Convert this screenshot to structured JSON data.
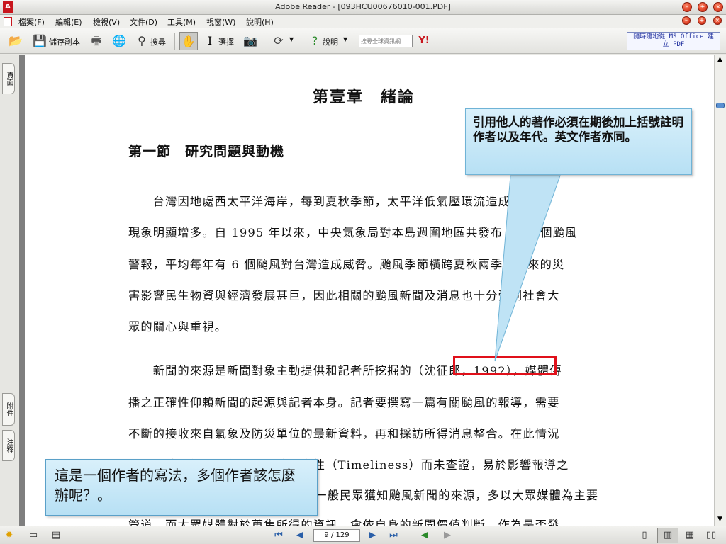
{
  "window": {
    "title": "Adobe Reader - [093HCU00676010-001.PDF]"
  },
  "menu": [
    "檔案(F)",
    "編輯(E)",
    "檢視(V)",
    "文件(D)",
    "工具(M)",
    "視窗(W)",
    "說明(H)"
  ],
  "toolbar": {
    "save_copy": "儲存副本",
    "search": "搜尋",
    "select": "選擇",
    "help": "說明",
    "search_placeholder": "搜尋全球資訊網",
    "ad_line1": "隨時隨地從 MS Office 建",
    "ad_line2": "立 PDF"
  },
  "leftpanel": {
    "pages_tab": "頁面",
    "attachments_tab": "附件",
    "comments_tab": "注釋"
  },
  "document": {
    "chapter_title": "第壹章　緒論",
    "section_title": "第一節　研究問題與動機",
    "p1": [
      "　　台灣因地處西太平洋海岸，每到夏秋季節，太平洋低氣壓環流造成的氣候",
      "現象明顯增多。自 1995 年以來，中央氣象局對本島週圍地區共發布 80 多個颱風",
      "警報，平均每年有 6 個颱風對台灣造成威脅。颱風季節橫跨夏秋兩季，帶來的災",
      "害影響民生物資與經濟發展甚巨，因此相關的颱風新聞及消息也十分受到社會大",
      "眾的關心與重視。"
    ],
    "p2": [
      "　　新聞的來源是新聞對象主動提供和記者所挖掘的（沈征郎，1992），媒體傳",
      "播之正確性仰賴新聞的起源與記者本身。記者要撰寫一篇有關颱風的報導，需要",
      "不斷的接收來自氣象及防災單位的最新資料，再和採訪所得消息整合。在此情況",
      "下，媒體可能為了顧及新聞的時宜性（Timeliness）而未查證，易於影響報導之",
      "正確性。由於一般民眾獲知颱風新聞的來源，多以大眾媒體為主要",
      "管道。而大眾媒體對於蒐集所得的資訊，會依自身的新聞價值判斷，作為是否發"
    ]
  },
  "callouts": {
    "top": "引用他人的著作必須在期後加上括號註明作者以及年代。英文作者亦同。",
    "bottom": "這是一個作者的寫法，多個作者該怎麼辦呢？。"
  },
  "statusbar": {
    "page_indicator": "9 / 129"
  }
}
